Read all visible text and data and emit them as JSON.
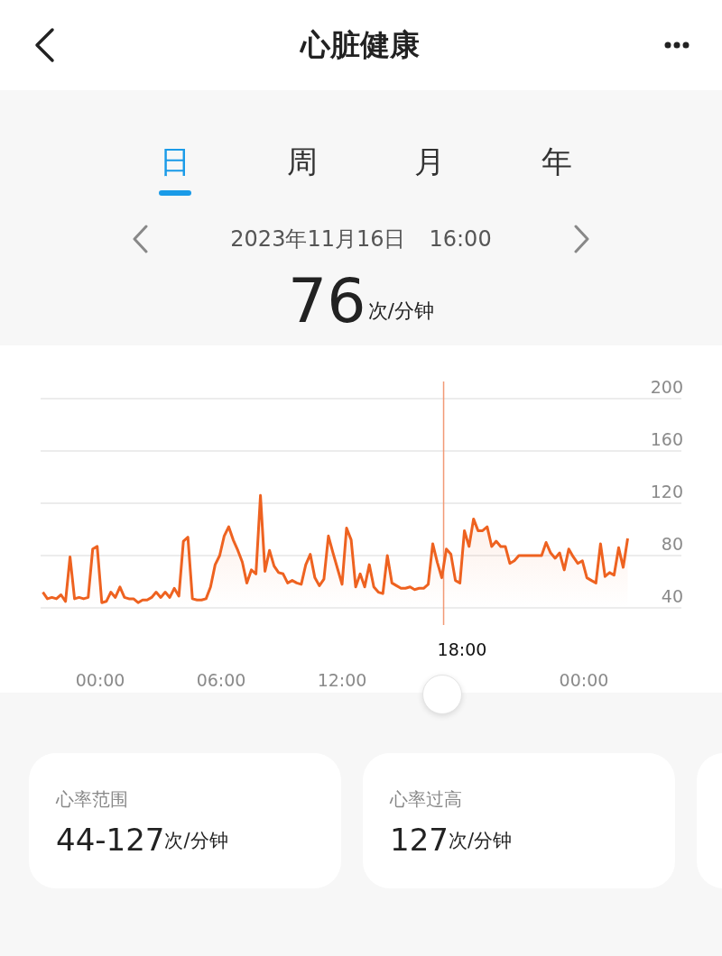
{
  "header": {
    "title": "心脏健康"
  },
  "tabs": [
    {
      "label": "日",
      "selected": true
    },
    {
      "label": "周",
      "selected": false
    },
    {
      "label": "月",
      "selected": false
    },
    {
      "label": "年",
      "selected": false
    }
  ],
  "date_nav": {
    "date": "2023年11月16日",
    "time": "16:00"
  },
  "reading": {
    "value": "76",
    "unit": "次/分钟"
  },
  "cursor": {
    "label": "18:00"
  },
  "chart_data": {
    "type": "area",
    "grid": true,
    "ref_lines": [
      {
        "axis": "x",
        "value": 17.04,
        "color": "#f29a76"
      }
    ],
    "xlim": [
      -2.96,
      28.84
    ],
    "ylim": [
      40,
      200
    ],
    "yticks": [
      40,
      80,
      120,
      160,
      200
    ],
    "xticks": [
      {
        "value": 0,
        "label": "00:00"
      },
      {
        "value": 6,
        "label": "06:00"
      },
      {
        "value": 12,
        "label": "12:00"
      },
      {
        "value": 24,
        "label": "00:00"
      }
    ],
    "x": [
      -2.85,
      -2.625,
      -2.4,
      -2.175,
      -1.95,
      -1.725,
      -1.5,
      -1.275,
      -1.05,
      -0.825,
      -0.6,
      -0.375,
      -0.15,
      0.075,
      0.3,
      0.525,
      0.75,
      0.975,
      1.2,
      1.425,
      1.65,
      1.875,
      2.1,
      2.325,
      2.55,
      2.775,
      3,
      3.225,
      3.45,
      3.675,
      3.9,
      4.125,
      4.35,
      4.575,
      4.8,
      5.025,
      5.25,
      5.475,
      5.7,
      5.925,
      6.15,
      6.375,
      6.6,
      6.825,
      7.05,
      7.275,
      7.5,
      7.725,
      7.95,
      8.175,
      8.4,
      8.625,
      8.85,
      9.075,
      9.3,
      9.525,
      9.75,
      9.975,
      10.2,
      10.425,
      10.65,
      10.875,
      11.1,
      11.325,
      11.55,
      11.775,
      12,
      12.225,
      12.45,
      12.675,
      12.9,
      13.125,
      13.35,
      13.575,
      13.8,
      14.025,
      14.25,
      14.475,
      14.7,
      14.925,
      15.15,
      15.375,
      15.6,
      15.825,
      16.05,
      16.275,
      16.5,
      16.725,
      16.95,
      17.175,
      17.4,
      17.625,
      17.85,
      18.075,
      18.3,
      18.525,
      18.75,
      18.975,
      19.2,
      19.425,
      19.65,
      19.875,
      20.1,
      20.325,
      20.55,
      20.775,
      21,
      21.225,
      21.45,
      21.675,
      21.9,
      22.125,
      22.35,
      22.575,
      22.8,
      23.025,
      23.25,
      23.475,
      23.7,
      23.925,
      24.15,
      24.375,
      24.6,
      24.825,
      25.05,
      25.275,
      25.5,
      25.725,
      25.95,
      26.175
    ],
    "series": [
      {
        "color": "#ee6220",
        "values": [
          52,
          47,
          48,
          47,
          50,
          45,
          79,
          47,
          48,
          47,
          48,
          85,
          87,
          44,
          45,
          52,
          48,
          56,
          48,
          47,
          47,
          44,
          46,
          46,
          48,
          52,
          48,
          52,
          48,
          55,
          49,
          91,
          94,
          47,
          46,
          46,
          47,
          56,
          73,
          80,
          95,
          102,
          92,
          84,
          75,
          59,
          69,
          66,
          126,
          68,
          84,
          72,
          67,
          66,
          59,
          61,
          59,
          58,
          73,
          81,
          63,
          57,
          62,
          95,
          82,
          70,
          58,
          101,
          92,
          56,
          66,
          56,
          73,
          56,
          52,
          51,
          80,
          59,
          57,
          55,
          55,
          56,
          54,
          55,
          55,
          58,
          89,
          75,
          63,
          85,
          81,
          61,
          59,
          99,
          87,
          108,
          99,
          99,
          102,
          87,
          91,
          87,
          87,
          74,
          76,
          80,
          80,
          80,
          80,
          80,
          80,
          90,
          82,
          78,
          82,
          69,
          85,
          79,
          74,
          76,
          63,
          61,
          59,
          89,
          64,
          67,
          65,
          86,
          71,
          93
        ]
      }
    ]
  },
  "cards": [
    {
      "title": "心率范围",
      "value": "44-127",
      "unit": "次/分钟"
    },
    {
      "title": "心率过高",
      "value": "127",
      "unit": "次/分钟"
    }
  ]
}
